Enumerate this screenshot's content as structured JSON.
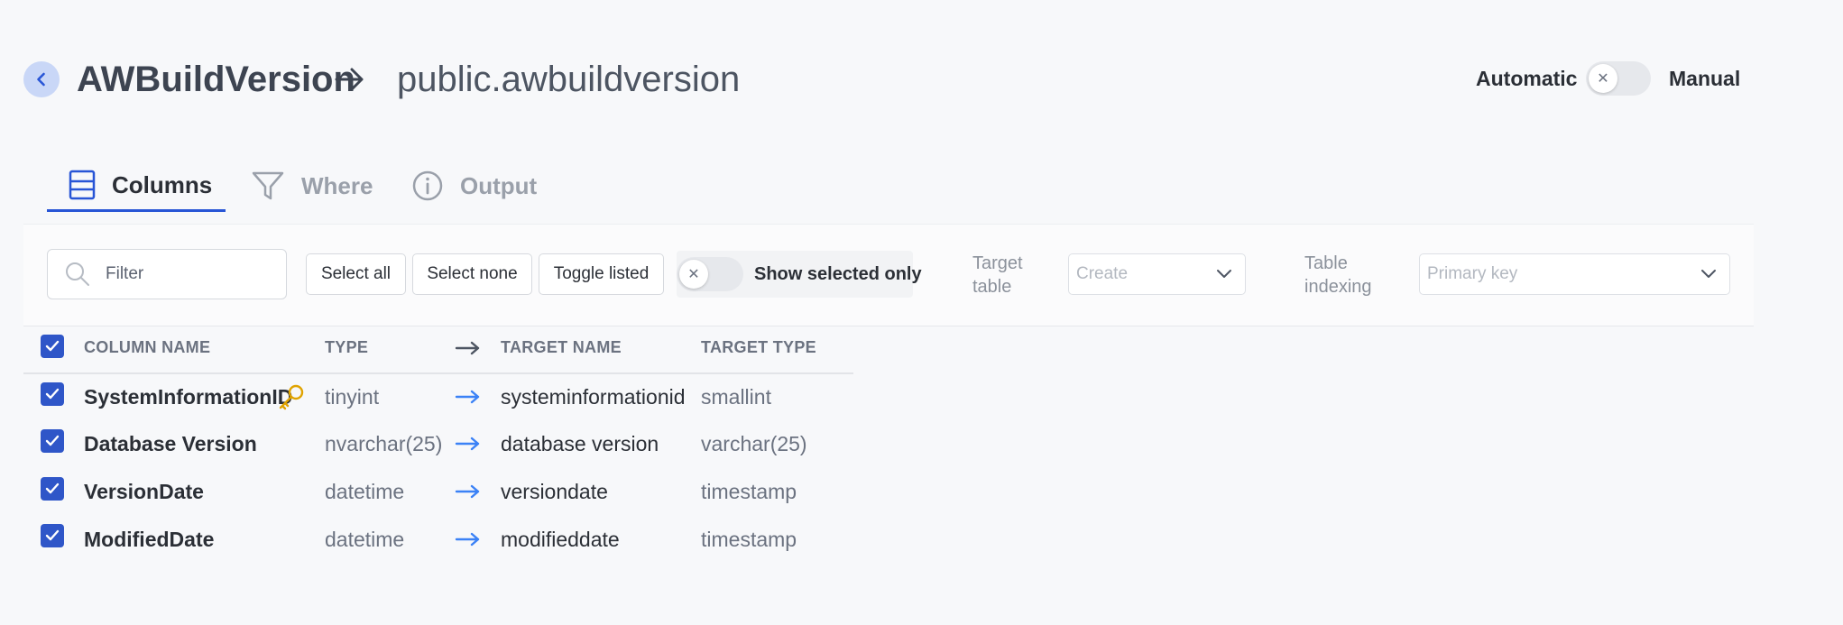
{
  "header": {
    "source_table": "AWBuildVersion",
    "target_table": "public.awbuildversion",
    "mode_left": "Automatic",
    "mode_right": "Manual"
  },
  "tabs": [
    {
      "label": "Columns",
      "active": true,
      "icon": "columns-icon"
    },
    {
      "label": "Where",
      "active": false,
      "icon": "filter-funnel-icon"
    },
    {
      "label": "Output",
      "active": false,
      "icon": "info-icon"
    }
  ],
  "toolbar": {
    "filter_placeholder": "Filter",
    "select_all": "Select all",
    "select_none": "Select none",
    "toggle_listed": "Toggle listed",
    "show_selected_only": "Show selected only",
    "target_table_label_1": "Target",
    "target_table_label_2": "table",
    "target_table_value": "Create",
    "table_indexing_label_1": "Table",
    "table_indexing_label_2": "indexing",
    "table_indexing_value": "Primary key"
  },
  "table": {
    "headers": {
      "column_name": "COLUMN NAME",
      "type": "TYPE",
      "target_name": "TARGET NAME",
      "target_type": "TARGET TYPE"
    },
    "rows": [
      {
        "name": "SystemInformationID",
        "type": "tinyint",
        "target_name": "systeminformationid",
        "target_type": "smallint",
        "primary_key": true,
        "checked": true
      },
      {
        "name": "Database Version",
        "type": "nvarchar(25)",
        "target_name": "database version",
        "target_type": "varchar(25)",
        "primary_key": false,
        "checked": true
      },
      {
        "name": "VersionDate",
        "type": "datetime",
        "target_name": "versiondate",
        "target_type": "timestamp",
        "primary_key": false,
        "checked": true
      },
      {
        "name": "ModifiedDate",
        "type": "datetime",
        "target_name": "modifieddate",
        "target_type": "timestamp",
        "primary_key": false,
        "checked": true
      }
    ]
  },
  "colors": {
    "accent": "#2855d6",
    "checkbox": "#2f56c8",
    "key_icon": "#e0a300",
    "mapping_arrow": "#3b82f6"
  }
}
